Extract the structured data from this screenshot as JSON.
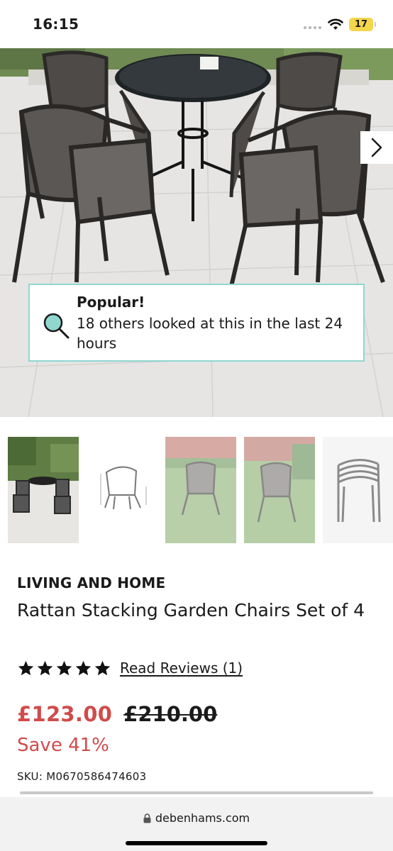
{
  "status_bar": {
    "time": "16:15",
    "battery": "17"
  },
  "popular": {
    "title": "Popular!",
    "text": "18 others looked at this in the last 24 hours"
  },
  "product": {
    "brand": "LIVING AND HOME",
    "title": "Rattan Stacking Garden Chairs Set of 4",
    "rating": 5,
    "reviews_link": "Read Reviews (1)",
    "price_now": "£123.00",
    "price_was": "£210.00",
    "save": "Save 41%",
    "sku": "SKU: M0670586474603"
  },
  "browser": {
    "url": "debenhams.com"
  },
  "icons": {
    "next": "chevron-right-icon",
    "popular": "magnifier-icon",
    "lock": "lock-icon",
    "star": "star-icon"
  },
  "colors": {
    "sale": "#d04b4b",
    "accent": "#8fd7cf"
  }
}
